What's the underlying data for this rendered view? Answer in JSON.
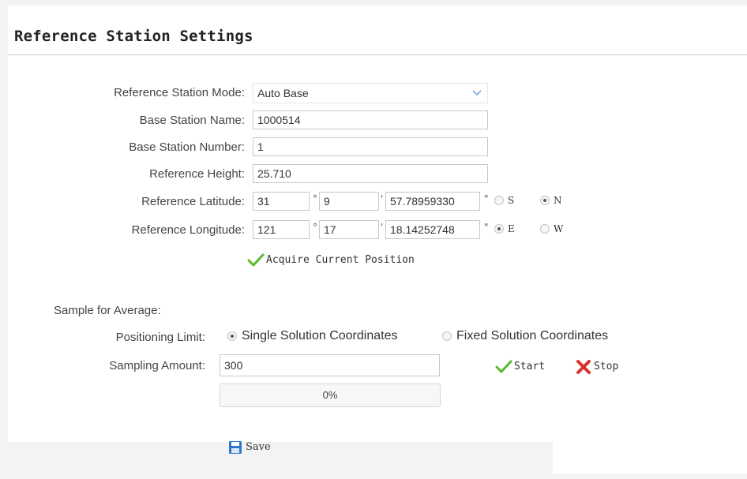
{
  "title": "Reference Station Settings",
  "labels": {
    "mode": "Reference Station Mode:",
    "name": "Base Station Name:",
    "number": "Base Station Number:",
    "height": "Reference Height:",
    "latitude": "Reference Latitude:",
    "longitude": "Reference Longitude:",
    "sample": "Sample for Average:",
    "limit": "Positioning Limit:",
    "amount": "Sampling Amount:"
  },
  "fields": {
    "mode": "Auto Base",
    "name": "1000514",
    "number": "1",
    "height": "25.710",
    "lat_deg": "31",
    "lat_min": "9",
    "lat_sec": "57.78959330",
    "lon_deg": "121",
    "lon_min": "17",
    "lon_sec": "18.14252748",
    "amount": "300"
  },
  "symbols": {
    "degree": "°",
    "minute": "'",
    "second": "\""
  },
  "lat_dir": {
    "options": [
      "S",
      "N"
    ],
    "selected": "N"
  },
  "lon_dir": {
    "options": [
      "E",
      "W"
    ],
    "selected": "E"
  },
  "acquire_label": "Acquire Current Position",
  "limit_options": [
    "Single Solution Coordinates",
    "Fixed Solution Coordinates"
  ],
  "limit_selected": "Single Solution Coordinates",
  "start_label": "Start",
  "stop_label": "Stop",
  "progress": {
    "text": "0%",
    "value": 0
  },
  "save_label": "Save",
  "colors": {
    "check": "#5cb82f",
    "stop": "#d9312b",
    "save": "#2e76c7"
  }
}
